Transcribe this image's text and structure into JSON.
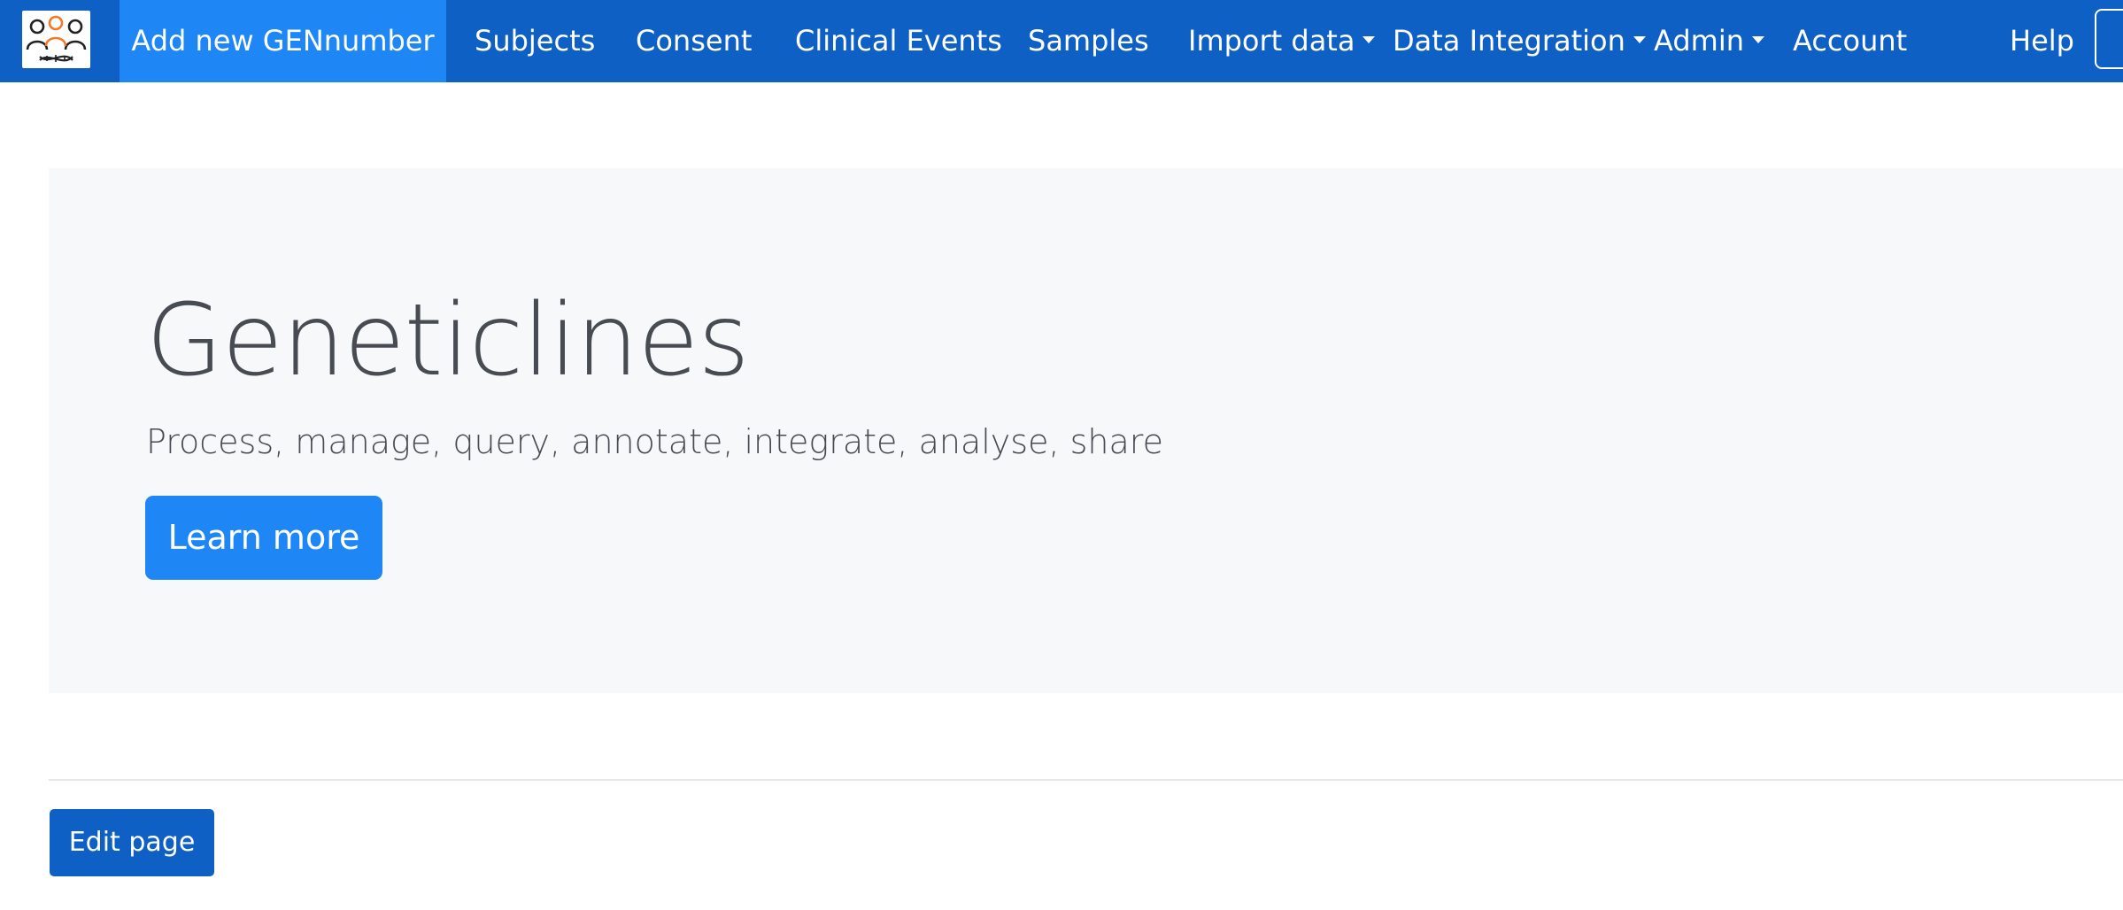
{
  "navbar": {
    "brand_logo_icon": "geneticlines-logo-icon",
    "items": [
      {
        "label": "Add new GENnumber",
        "active": true
      },
      {
        "label": "Subjects"
      },
      {
        "label": "Consent"
      },
      {
        "label": "Clinical Events"
      },
      {
        "label": "Samples"
      },
      {
        "label": "Import data",
        "dropdown": true
      },
      {
        "label": "Data Integration",
        "dropdown": true
      },
      {
        "label": "Admin",
        "dropdown": true
      },
      {
        "label": "Account"
      },
      {
        "label": "Help"
      }
    ]
  },
  "hero": {
    "title": "Geneticlines",
    "lead": "Process, manage, query, annotate, integrate, analyse, share",
    "cta_label": "Learn more"
  },
  "footer": {
    "edit_label": "Edit page"
  },
  "colors": {
    "navbar_bg": "#0f60c4",
    "active_nav_bg": "#1e86f5",
    "primary_button": "#1e86f5",
    "jumbotron_bg": "#f7f8fa",
    "text_muted": "#474c52"
  }
}
